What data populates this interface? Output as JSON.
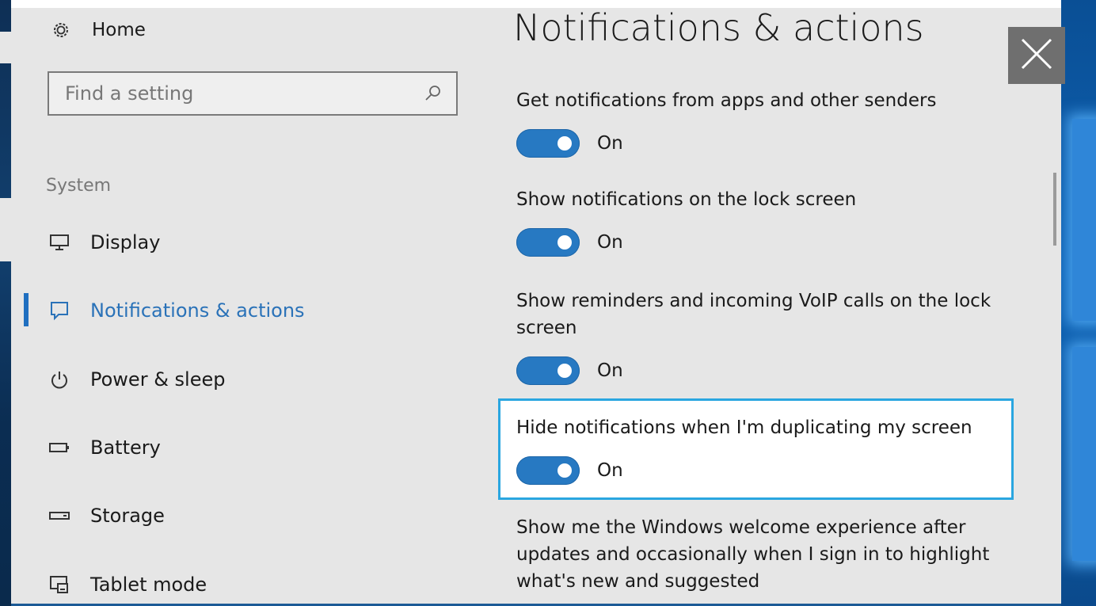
{
  "sidebar": {
    "home_label": "Home",
    "search_placeholder": "Find a setting",
    "section_label": "System",
    "items": [
      {
        "label": "Display",
        "icon": "monitor-icon"
      },
      {
        "label": "Notifications & actions",
        "icon": "message-icon",
        "active": true
      },
      {
        "label": "Power & sleep",
        "icon": "power-icon"
      },
      {
        "label": "Battery",
        "icon": "battery-icon"
      },
      {
        "label": "Storage",
        "icon": "storage-icon"
      },
      {
        "label": "Tablet mode",
        "icon": "tablet-mode-icon"
      }
    ]
  },
  "main": {
    "title": "Notifications & actions",
    "settings": [
      {
        "label": "Get notifications from apps and other senders",
        "state": "On"
      },
      {
        "label": "Show notifications on the lock screen",
        "state": "On"
      },
      {
        "label": "Show reminders and incoming VoIP calls on the lock screen",
        "state": "On"
      },
      {
        "label": "Hide notifications when I'm duplicating my screen",
        "state": "On",
        "highlighted": true
      },
      {
        "label": "Show me the Windows welcome experience after updates and occasionally when I sign in to highlight what's new and suggested"
      }
    ]
  },
  "colors": {
    "accent": "#2779c2",
    "highlight_border": "#2aa6e0",
    "window_bg": "#e6e6e6",
    "close_bg": "#6f6f6f"
  }
}
